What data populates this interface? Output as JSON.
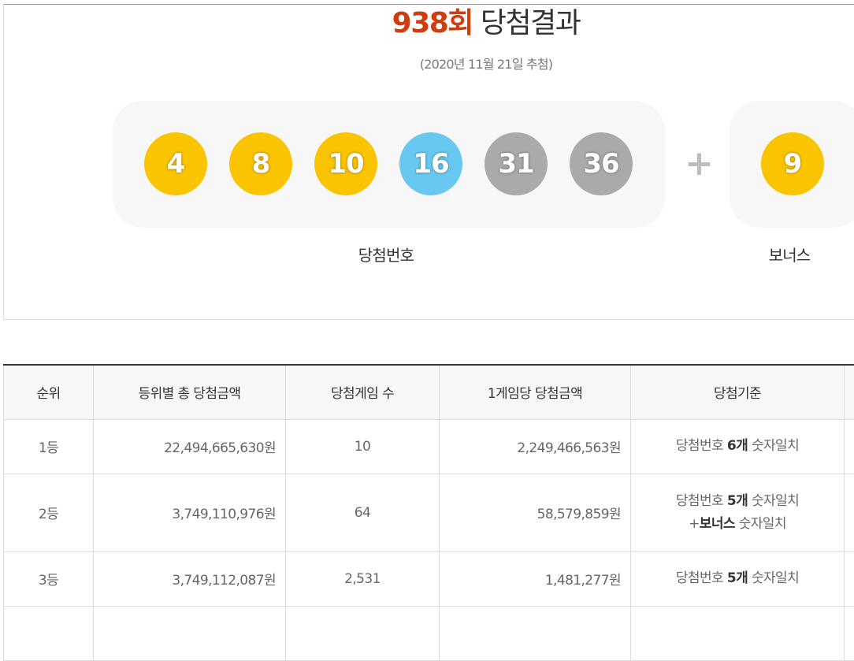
{
  "header": {
    "round_label": "938회",
    "title_suffix": " 당첨결과",
    "draw_date": "(2020년 11월 21일 추첨)"
  },
  "winning_numbers": [
    {
      "number": "4",
      "color": "#fbc400"
    },
    {
      "number": "8",
      "color": "#fbc400"
    },
    {
      "number": "10",
      "color": "#fbc400"
    },
    {
      "number": "16",
      "color": "#69c8f2"
    },
    {
      "number": "31",
      "color": "#aaaaaa"
    },
    {
      "number": "36",
      "color": "#aaaaaa"
    }
  ],
  "bonus": {
    "number": "9",
    "color": "#fbc400"
  },
  "plus_symbol": "+",
  "labels": {
    "winning": "당첨번호",
    "bonus": "보너스"
  },
  "table": {
    "headers": [
      "순위",
      "등위별 총 당첨금액",
      "당첨게임 수",
      "1게임당 당첨금액",
      "당첨기준"
    ],
    "rows": [
      {
        "rank": "1등",
        "total": "22,494,665,630원",
        "games": "10",
        "per_game": "2,249,466,563원",
        "criteria": [
          {
            "pre": "당첨번호 ",
            "bold": "6개",
            "post": " 숫자일치"
          }
        ]
      },
      {
        "rank": "2등",
        "total": "3,749,110,976원",
        "games": "64",
        "per_game": "58,579,859원",
        "criteria": [
          {
            "pre": "당첨번호 ",
            "bold": "5개",
            "post": " 숫자일치"
          },
          {
            "pre": "+",
            "bold": "보너스",
            "post": " 숫자일치"
          }
        ]
      },
      {
        "rank": "3등",
        "total": "3,749,112,087원",
        "games": "2,531",
        "per_game": "1,481,277원",
        "criteria": [
          {
            "pre": "당첨번호 ",
            "bold": "5개",
            "post": " 숫자일치"
          }
        ]
      }
    ]
  },
  "colors": {
    "accent": "#d23c0c",
    "panel_bg": "#f7f7f7"
  }
}
